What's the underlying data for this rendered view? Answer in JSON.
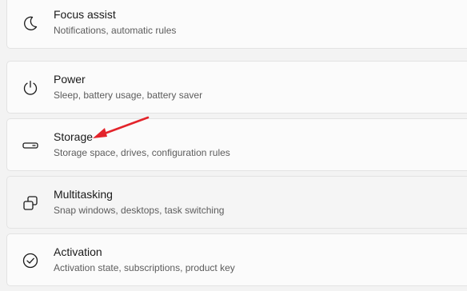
{
  "settings_list": {
    "items": [
      {
        "title": "Focus assist",
        "subtitle": "Notifications, automatic rules",
        "icon": "moon-icon"
      },
      {
        "title": "Power",
        "subtitle": "Sleep, battery usage, battery saver",
        "icon": "power-icon"
      },
      {
        "title": "Storage",
        "subtitle": "Storage space, drives, configuration rules",
        "icon": "storage-drive-icon"
      },
      {
        "title": "Multitasking",
        "subtitle": "Snap windows, desktops, task switching",
        "icon": "multitasking-icon"
      },
      {
        "title": "Activation",
        "subtitle": "Activation state, subscriptions, product key",
        "icon": "activation-check-icon"
      }
    ]
  },
  "annotation": {
    "arrow_color": "#e3242b",
    "points_to": "Storage"
  },
  "colors": {
    "background": "#f3f3f3",
    "card": "#fbfbfb",
    "card_hover": "#f5f5f5",
    "title_text": "#1a1a1a",
    "subtitle_text": "#5c5c5c"
  }
}
